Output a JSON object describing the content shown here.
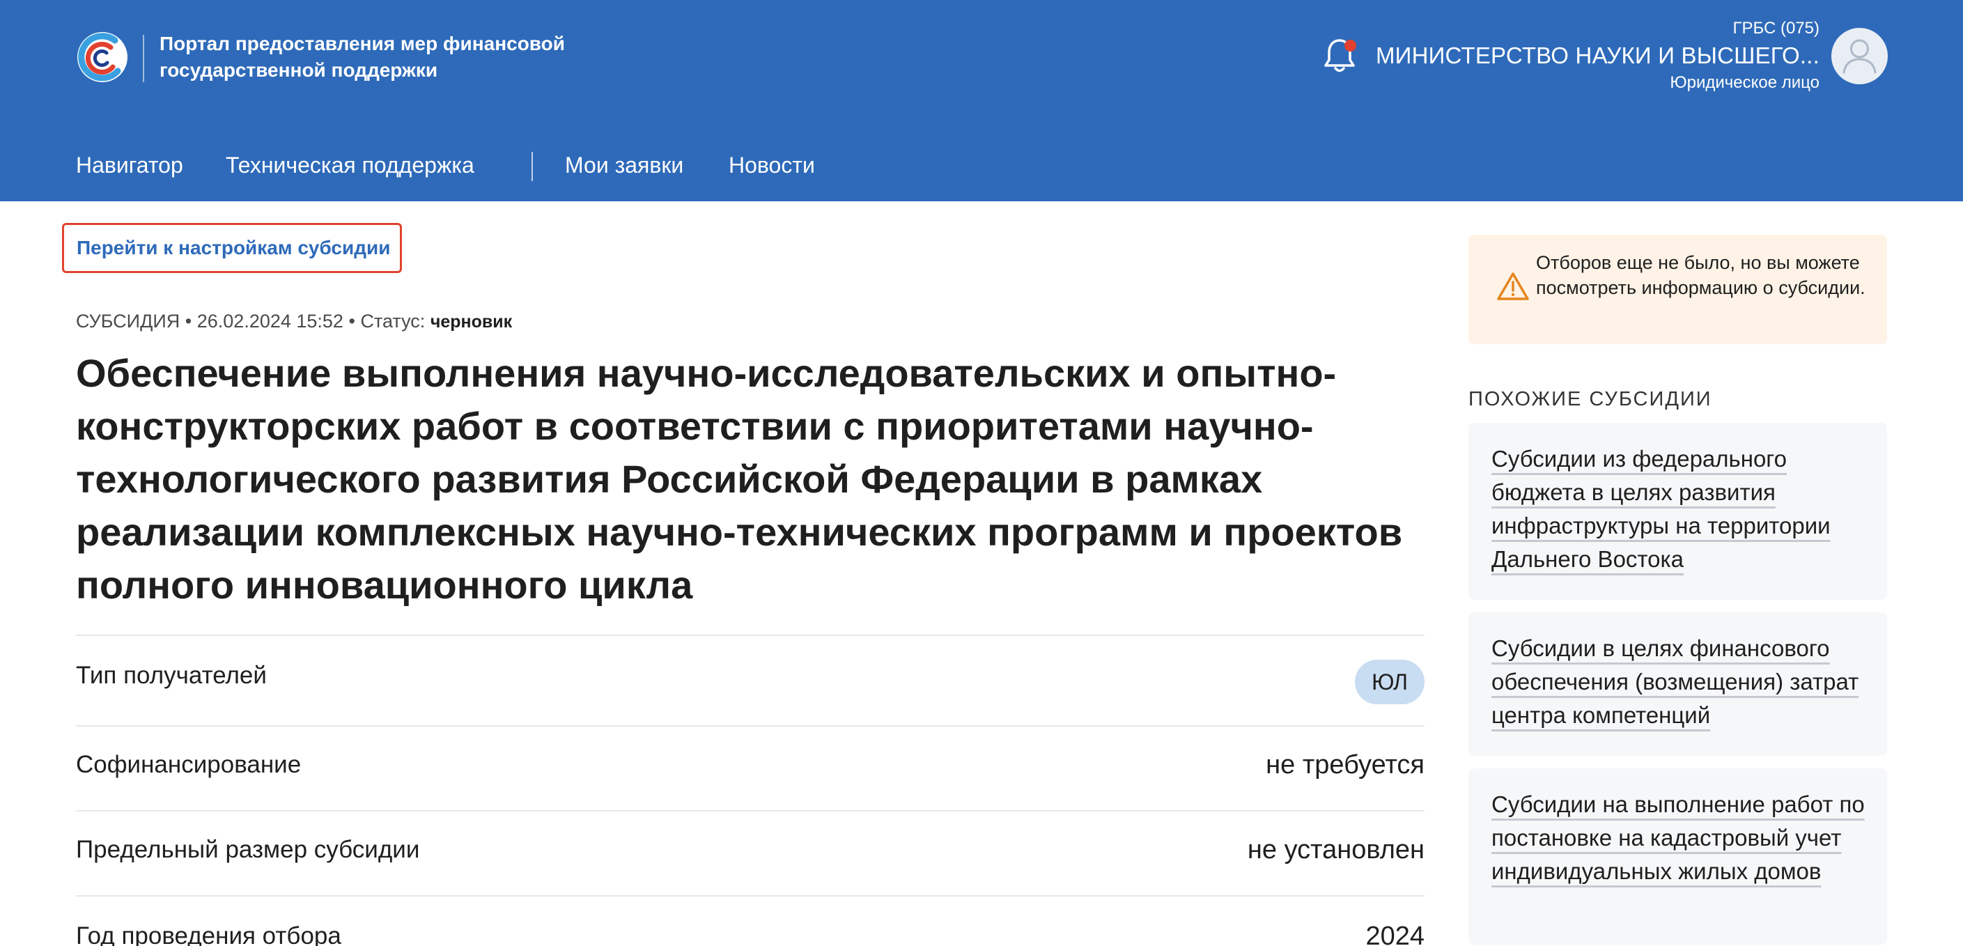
{
  "header": {
    "portal_name": "Портал предоставления мер финансовой государственной поддержки",
    "grbs": "ГРБС (075)",
    "organization": "МИНИСТЕРСТВО НАУКИ И ВЫСШЕГО...",
    "user_type": "Юридическое лицо",
    "has_notification": true,
    "brand_color": "#2e6ab9",
    "accent_color": "#e2412f"
  },
  "nav": {
    "items": [
      "Навигатор",
      "Техническая поддержка",
      "Мои заявки",
      "Новости"
    ]
  },
  "main": {
    "settings_link": "Перейти к настройкам субсидии",
    "meta": {
      "type": "СУБСИДИЯ",
      "date": "26.02.2024 15:52",
      "status_label": "Статус:",
      "status_value": "черновик"
    },
    "title": "Обеспечение выполнения научно-исследовательских и опытно-конструкторских работ в соответствии с приоритетами научно-технологического развития Российской Федерации в рамках реализации комплексных научно-технических программ и проектов полного инновационного цикла",
    "rows": [
      {
        "label": "Тип получателей",
        "value": "ЮЛ"
      },
      {
        "label": "Софинансирование",
        "value": "не требуется"
      },
      {
        "label": "Предельный размер субсидии",
        "value": "не установлен"
      },
      {
        "label": "Год проведения отбора",
        "value": "2024"
      }
    ]
  },
  "sidebar": {
    "notice": "Отборов еще не было, но вы можете посмотреть информацию о субсидии.",
    "similar_title": "ПОХОЖИЕ СУБСИДИИ",
    "similar": [
      "Субсидии из федерального бюджета в целях развития инфраструктуры на территории Дальнего Востока",
      "Субсидии в целях финансового обеспечения (возмещения) затрат центра компетенций",
      "Субсидии на выполнение работ по постановке на кадастровый учет индивидуальных жилых домов"
    ]
  }
}
